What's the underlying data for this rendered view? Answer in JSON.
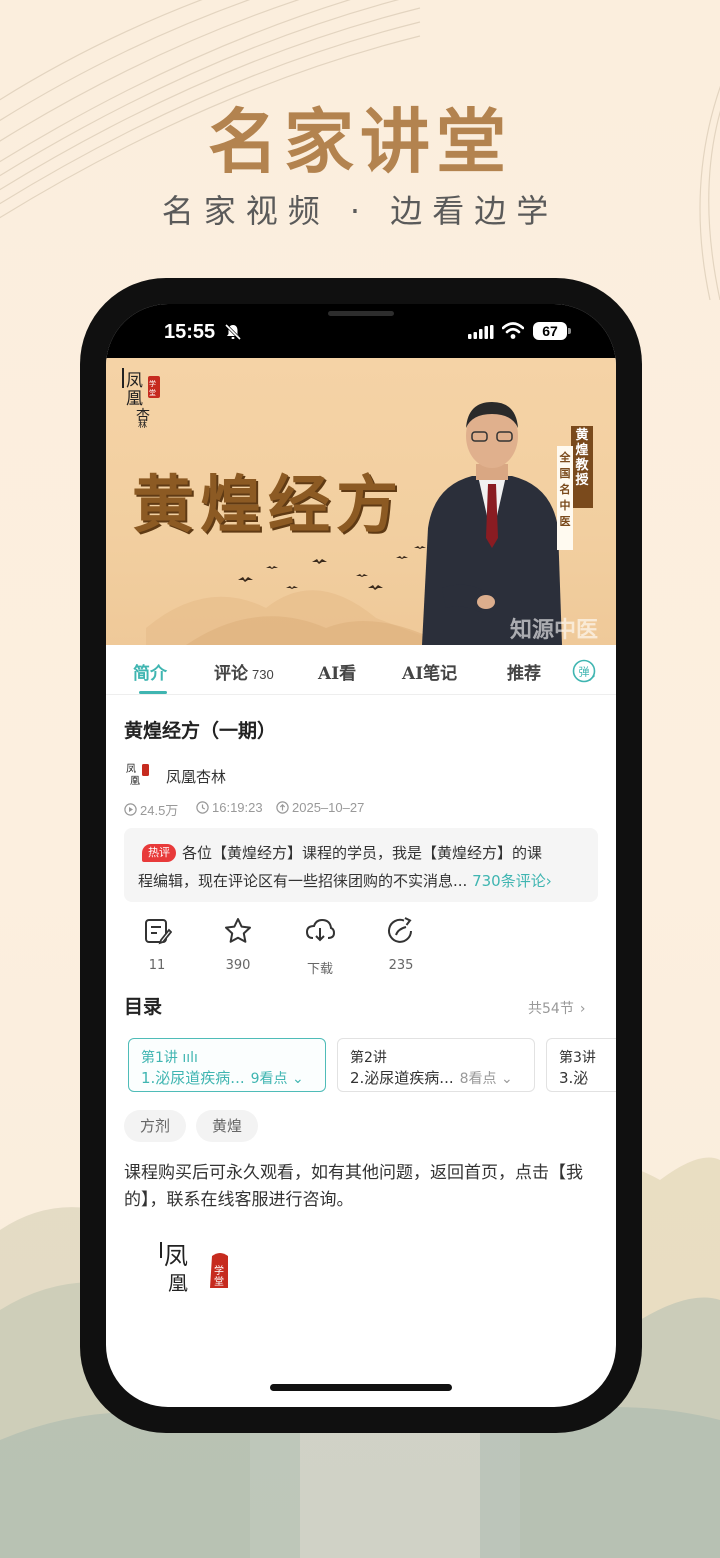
{
  "promo": {
    "title": "名家讲堂",
    "subtitle": "名家视频 · 边看边学"
  },
  "status_bar": {
    "time": "15:55",
    "battery": "67"
  },
  "banner": {
    "logo_text": "凤凰杏林",
    "title": "黄煌经方",
    "presenter_name": "黄煌",
    "presenter_role": "教授",
    "presenter_rank": "全国名中医",
    "watermark": "知源中医"
  },
  "tabs": [
    {
      "label": "简介",
      "count": "",
      "active": true
    },
    {
      "label": "评论",
      "count": "730",
      "active": false
    },
    {
      "label": "AI看",
      "count": "",
      "active": false
    },
    {
      "label": "AI笔记",
      "count": "",
      "active": false
    },
    {
      "label": "推荐",
      "count": "",
      "active": false
    }
  ],
  "danmu_label": "弹",
  "course": {
    "title": "黄煌经方（一期）",
    "publisher": "凤凰杏林",
    "views": "24.5万",
    "duration": "16:19:23",
    "date": "2025–10–27"
  },
  "notice": {
    "badge": "热评",
    "line1": "各位【黄煌经方】课程的学员，我是【黄煌经方】的课",
    "line2": "程编辑，现在评论区有一些招徕团购的不实消息...",
    "link": "730条评论›"
  },
  "actions": [
    {
      "icon": "note-icon",
      "label": "11"
    },
    {
      "icon": "star-icon",
      "label": "390"
    },
    {
      "icon": "download-icon",
      "label": "下载"
    },
    {
      "icon": "share-icon",
      "label": "235"
    }
  ],
  "catalog": {
    "title": "目录",
    "count": "共54节",
    "chevron": "›",
    "episodes": [
      {
        "num": "第1讲",
        "title": "1.泌尿道疾病...",
        "points": "9看点 ⌄",
        "active": true
      },
      {
        "num": "第2讲",
        "title": "2.泌尿道疾病...",
        "points": "8看点 ⌄",
        "active": false
      },
      {
        "num": "第3讲",
        "title": "3.泌",
        "points": "",
        "active": false
      }
    ]
  },
  "tags": [
    "方剂",
    "黄煌"
  ],
  "description": "课程购买后可永久观看，如有其他问题，返回首页，点击【我的】，联系在线客服进行咨询。",
  "colors": {
    "accent": "#3fb5b1",
    "promo_title": "#b3834f",
    "hot_badge": "#e83a3a"
  }
}
